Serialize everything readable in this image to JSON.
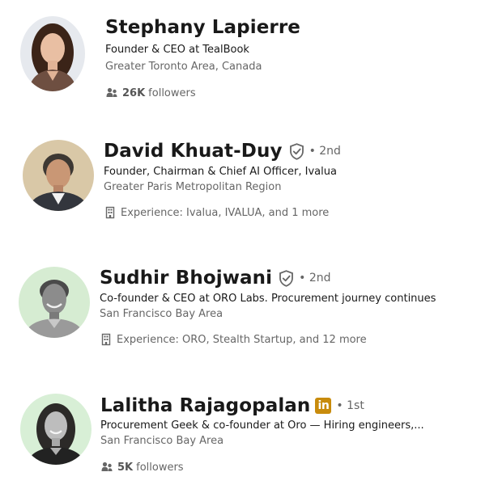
{
  "results": [
    {
      "name": "Stephany Lapierre",
      "headline": "Founder & CEO at TealBook",
      "location": "Greater Toronto Area, Canada",
      "followers_count": "26K",
      "followers_label": "followers"
    },
    {
      "name": "David Khuat-Duy",
      "verified_icon": "verified-shield-icon",
      "degree": "• 2nd",
      "headline": "Founder, Chairman & Chief AI Officer, Ivalua",
      "location": "Greater Paris Metropolitan Region",
      "experience": "Experience: Ivalua, IVALUA, and 1 more"
    },
    {
      "name": "Sudhir Bhojwani",
      "verified_icon": "verified-shield-icon",
      "degree": "• 2nd",
      "headline": "Co-founder & CEO at ORO Labs. Procurement journey continues",
      "location": "San Francisco Bay Area",
      "experience": "Experience: ORO, Stealth Startup, and 12 more"
    },
    {
      "name": "Lalitha Rajagopalan",
      "premium_badge": "in",
      "degree": "• 1st",
      "headline": "Procurement Geek & co-founder at Oro — Hiring engineers,...",
      "location": "San Francisco Bay Area",
      "followers_count": "5K",
      "followers_label": "followers"
    }
  ],
  "colors": {
    "premium_badge": "#c88b0c",
    "secondary_text": "#666666",
    "primary_text": "#191919"
  }
}
